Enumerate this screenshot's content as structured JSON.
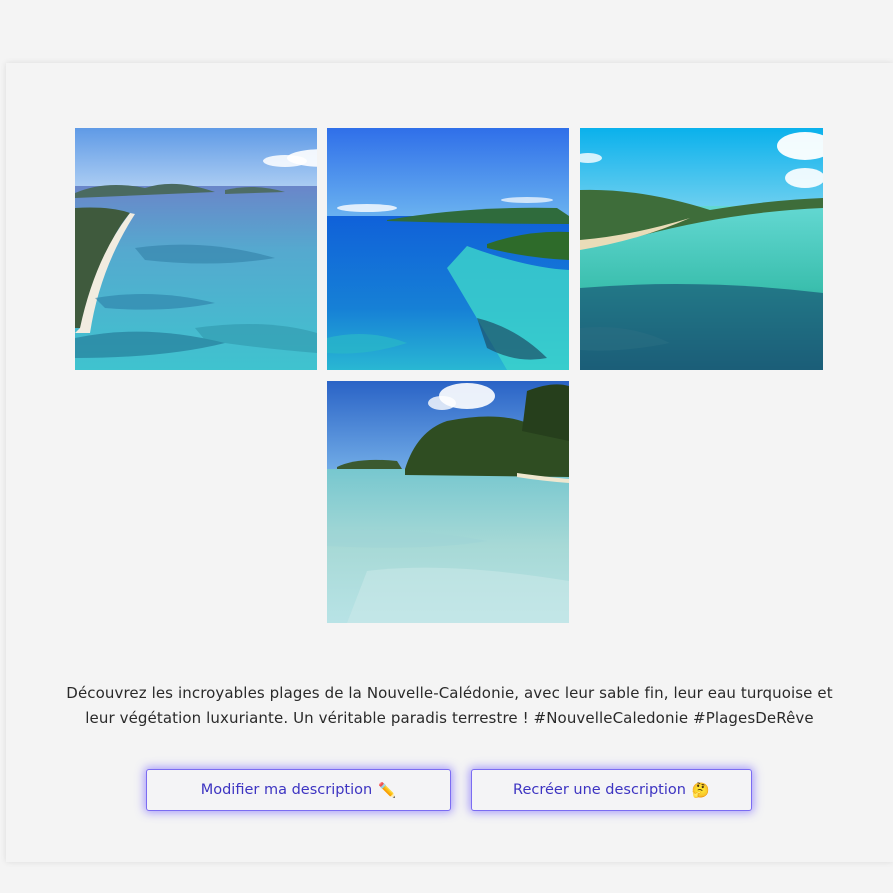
{
  "gallery": {
    "images": [
      {
        "name": "aerial-lagoon-beach-photo"
      },
      {
        "name": "aerial-reef-bay-photo"
      },
      {
        "name": "shallow-lagoon-photo"
      },
      {
        "name": "cliff-beach-photo"
      }
    ]
  },
  "description": "Découvrez les incroyables plages de la Nouvelle-Calédonie, avec leur sable fin, leur eau turquoise et leur végétation luxuriante. Un véritable paradis terrestre ! #NouvelleCaledonie #PlagesDeRêve",
  "buttons": {
    "edit_label": "Modifier ma description",
    "edit_icon": "✏️",
    "regenerate_label": "Recréer une description",
    "regenerate_icon": "🤔"
  },
  "colors": {
    "accent": "#3d34c2",
    "button_glow": "#7b6cf2",
    "page_background": "#f4f4f4"
  }
}
